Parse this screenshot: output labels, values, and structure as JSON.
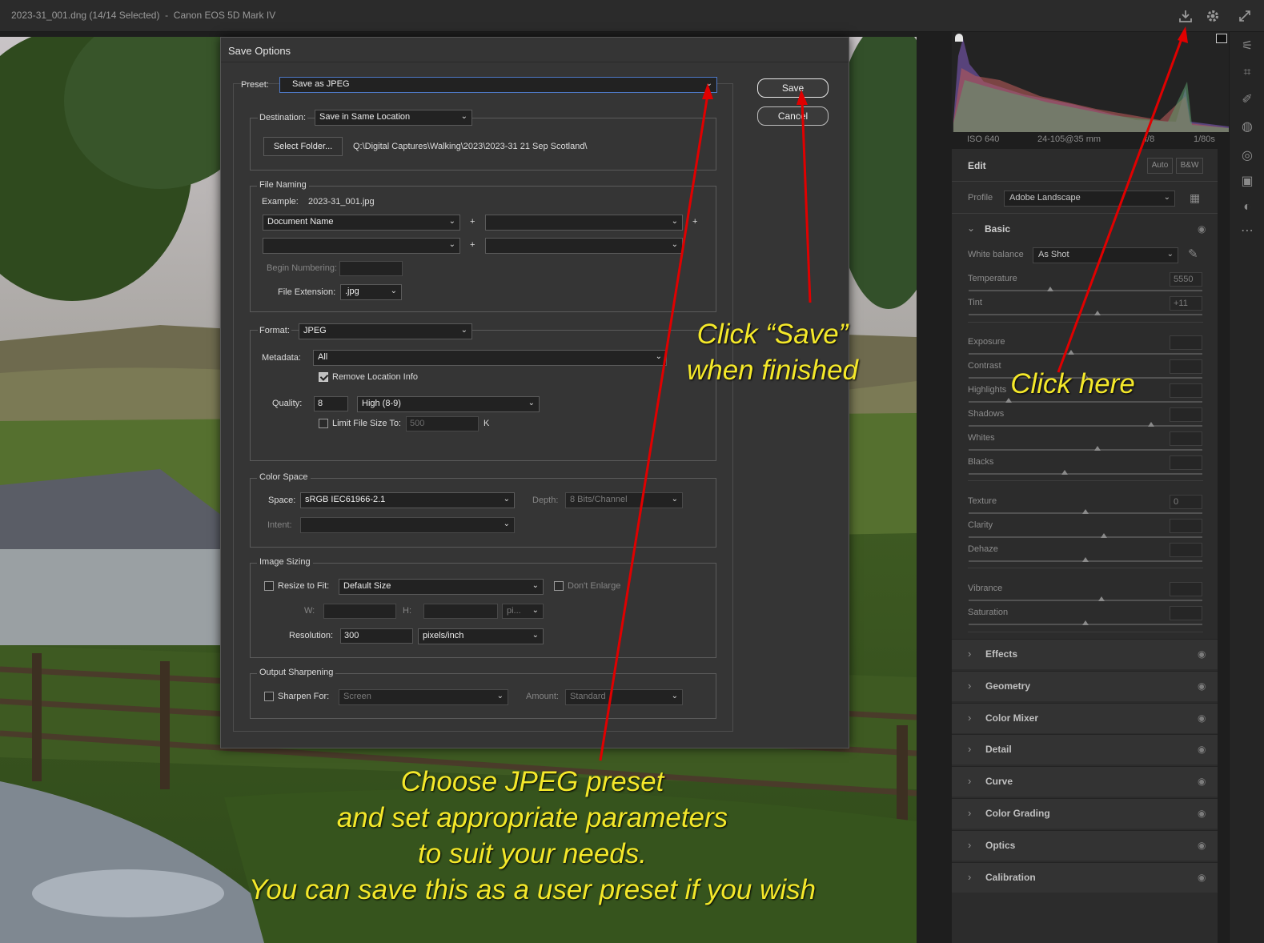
{
  "window_title": "2023-31_001.dng (14/14 Selected)  -  Canon EOS 5D Mark IV",
  "top_icons": {
    "save": "download-icon",
    "settings": "gear-icon",
    "expand": "expand-icon"
  },
  "exif": {
    "iso": "ISO 640",
    "lens": "24-105@35 mm",
    "aperture": "f/8",
    "shutter": "1/80s"
  },
  "edit": {
    "title": "Edit",
    "auto_label": "Auto",
    "bw_label": "B&W",
    "profile_label": "Profile",
    "profile_value": "Adobe Landscape",
    "basic_title": "Basic",
    "white_balance_label": "White balance",
    "white_balance_value": "As Shot",
    "sliders": [
      {
        "label": "Temperature",
        "value": "5550",
        "pos": 0.35
      },
      {
        "label": "Tint",
        "value": "+11",
        "pos": 0.55
      },
      {
        "label": "Exposure",
        "value": "",
        "pos": 0.44
      },
      {
        "label": "Contrast",
        "value": "",
        "pos": 0.5
      },
      {
        "label": "Highlights",
        "value": "",
        "pos": 0.17
      },
      {
        "label": "Shadows",
        "value": "",
        "pos": 0.78
      },
      {
        "label": "Whites",
        "value": "",
        "pos": 0.55
      },
      {
        "label": "Blacks",
        "value": "",
        "pos": 0.41
      },
      {
        "label": "Texture",
        "value": "0",
        "pos": 0.5
      },
      {
        "label": "Clarity",
        "value": "",
        "pos": 0.58
      },
      {
        "label": "Dehaze",
        "value": "",
        "pos": 0.5
      },
      {
        "label": "Vibrance",
        "value": "",
        "pos": 0.57
      },
      {
        "label": "Saturation",
        "value": "",
        "pos": 0.5
      }
    ],
    "sections": [
      "Effects",
      "Geometry",
      "Color Mixer",
      "Detail",
      "Curve",
      "Color Grading",
      "Optics",
      "Calibration"
    ]
  },
  "dialog": {
    "title": "Save Options",
    "preset_label": "Preset:",
    "preset_value": "Save as JPEG",
    "save_label": "Save",
    "cancel_label": "Cancel",
    "destination_label": "Destination:",
    "destination_value": "Save in Same Location",
    "select_folder_label": "Select Folder...",
    "folder_path": "Q:\\Digital Captures\\Walking\\2023\\2023-31 21 Sep Scotland\\",
    "file_naming_title": "File Naming",
    "example_label": "Example:",
    "example_value": "2023-31_001.jpg",
    "naming_1": "Document Name",
    "plus": "+",
    "begin_numbering_label": "Begin Numbering:",
    "file_extension_label": "File Extension:",
    "file_extension_value": ".jpg",
    "format_label": "Format:",
    "format_value": "JPEG",
    "metadata_label": "Metadata:",
    "metadata_value": "All",
    "remove_location_label": "Remove Location Info",
    "remove_location_checked": true,
    "quality_label": "Quality:",
    "quality_value": "8",
    "quality_level": "High  (8-9)",
    "limit_label": "Limit File Size To:",
    "limit_value": "500",
    "limit_unit": "K",
    "color_space_title": "Color Space",
    "space_label": "Space:",
    "space_value": "sRGB IEC61966-2.1",
    "depth_label": "Depth:",
    "depth_value": "8 Bits/Channel",
    "intent_label": "Intent:",
    "image_sizing_title": "Image Sizing",
    "resize_label": "Resize to Fit:",
    "resize_value": "Default Size",
    "dont_enlarge_label": "Don't Enlarge",
    "w_label": "W:",
    "h_label": "H:",
    "units_value": "pi...",
    "resolution_label": "Resolution:",
    "resolution_value": "300",
    "resolution_unit": "pixels/inch",
    "output_sharpening_title": "Output Sharpening",
    "sharpen_label": "Sharpen For:",
    "sharpen_value": "Screen",
    "amount_label": "Amount:",
    "amount_value": "Standard"
  },
  "annotations": {
    "save_note_1": "Click “Save”",
    "save_note_2": "when finished",
    "click_here": "Click here",
    "preset_note_1": "Choose JPEG preset",
    "preset_note_2": "and set appropriate parameters",
    "preset_note_3": "to suit your needs.",
    "preset_note_4": "You can save this as a user preset if you wish",
    "arrow_color": "#e00000",
    "text_color": "#f4e82a"
  }
}
